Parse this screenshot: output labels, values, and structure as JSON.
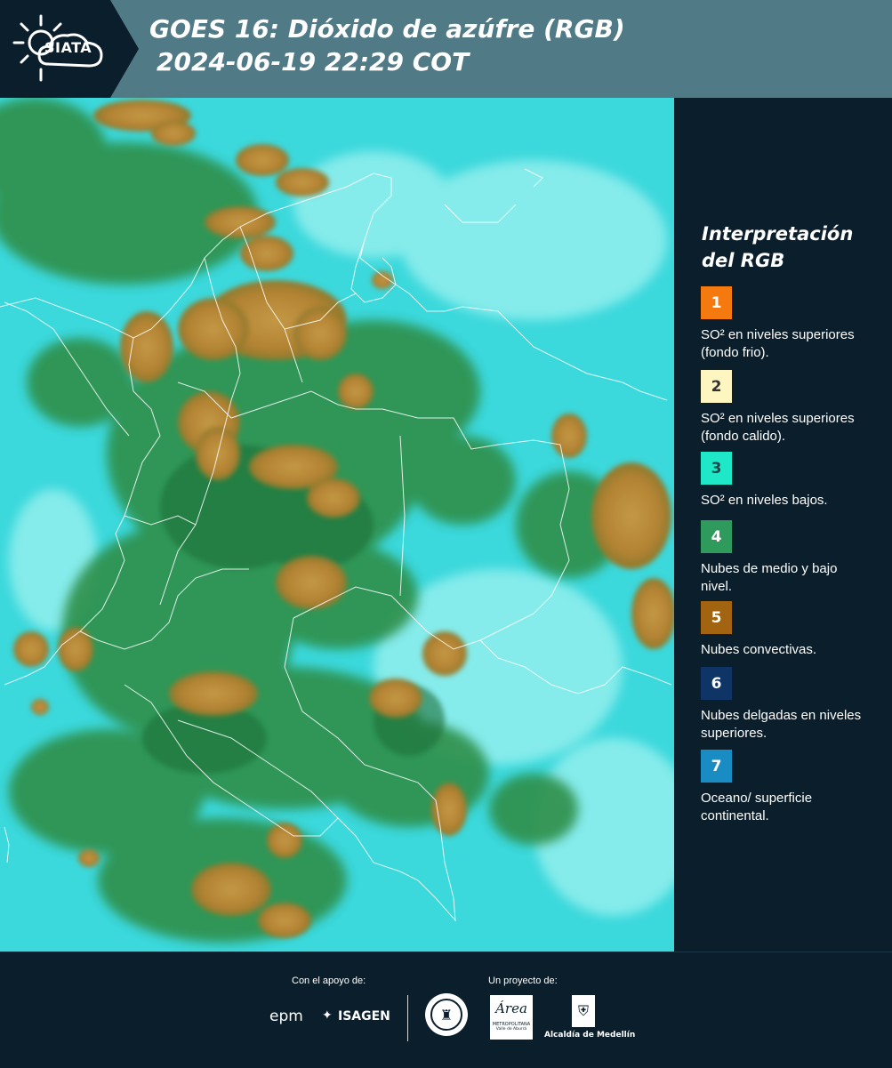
{
  "header": {
    "logo_text": "SIATA",
    "title_line1": "GOES 16: Dióxido de azúfre (RGB)",
    "title_line2": "2024-06-19 22:29 COT"
  },
  "legend": {
    "title_line1": "Interpretación",
    "title_line2": "del RGB",
    "items": [
      {
        "number": "1",
        "color": "#f47a10",
        "text_color": "#ffffff",
        "label": "SO² en niveles superiores (fondo frio)."
      },
      {
        "number": "2",
        "color": "#fdf6c0",
        "text_color": "#333333",
        "label": "SO² en niveles superiores (fondo calido)."
      },
      {
        "number": "3",
        "color": "#1ee8c8",
        "text_color": "#1a4a4a",
        "label": "SO² en niveles bajos."
      },
      {
        "number": "4",
        "color": "#2e9a5c",
        "text_color": "#ffffff",
        "label": "Nubes de medio y bajo nivel."
      },
      {
        "number": "5",
        "color": "#a26410",
        "text_color": "#ffffff",
        "label": "Nubes convectivas."
      },
      {
        "number": "6",
        "color": "#0e3566",
        "text_color": "#ffffff",
        "label": "Nubes delgadas en niveles superiores."
      },
      {
        "number": "7",
        "color": "#1a8cc4",
        "text_color": "#ffffff",
        "label": "Oceano/ superficie continental."
      }
    ]
  },
  "footer": {
    "support_label": "Con el apoyo de:",
    "project_label": "Un proyecto de:",
    "sponsor_1": "epm",
    "sponsor_2": "ISAGEN",
    "partner_1": "Área",
    "partner_1_sub": "METROPOLITANA",
    "partner_1_sub2": "Valle de Aburrá",
    "partner_2": "Alcaldía de Medellín"
  },
  "colors": {
    "ocean_cyan": "#3bd8dc",
    "land_green": "#2e8f4a",
    "convective": "#b88a35",
    "panel_dark": "#0b1e2b",
    "header_band": "#517a87"
  }
}
